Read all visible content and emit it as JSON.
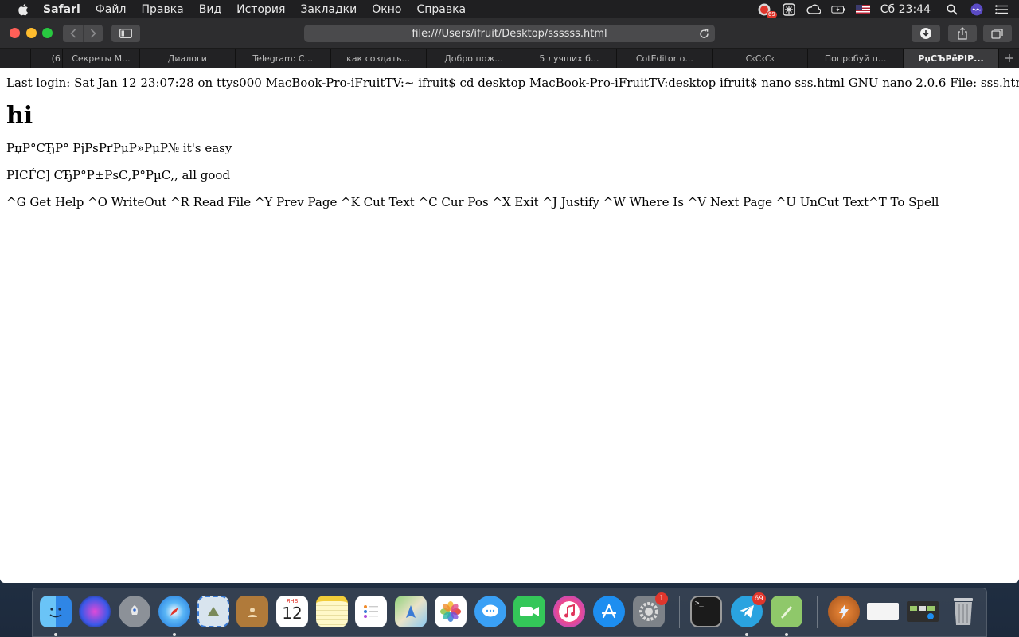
{
  "menubar": {
    "app_name": "Safari",
    "items": [
      "Файл",
      "Правка",
      "Вид",
      "История",
      "Закладки",
      "Окно",
      "Справка"
    ],
    "status_badge": "69",
    "clock": "Сб 23:44"
  },
  "browser": {
    "address": "file:///Users/ifruit/Desktop/ssssss.html",
    "tabs": [
      {
        "label": ""
      },
      {
        "label": "(6"
      },
      {
        "label": "Секреты М..."
      },
      {
        "label": "Диалоги"
      },
      {
        "label": "Telegram: С..."
      },
      {
        "label": "как создать..."
      },
      {
        "label": "Добро пож..."
      },
      {
        "label": "5 лучших б..."
      },
      {
        "label": "CotEditor о..."
      },
      {
        "label": "С‹С‹С‹"
      },
      {
        "label": "Попробуй п..."
      },
      {
        "label": "РџСЪРёРІР..."
      }
    ]
  },
  "page": {
    "line1": "Last login: Sat Jan 12 23:07:28 on ttys000 MacBook-Pro-iFruitTV:~ ifruit$ cd desktop MacBook-Pro-iFruitTV:desktop ifruit$ nano sss.html GNU nano 2.0.6 File: sss.html Modified",
    "heading": "hi",
    "line2": "РџР°СЂР° РјРѕРґРµР»РµР№ it's easy",
    "line3": "РІСЃС] СЂР°Р±РѕС‚Р°РµС‚, all good",
    "line4": "^G Get Help ^O WriteOut ^R Read File ^Y Prev Page ^K Cut Text ^C Cur Pos ^X Exit ^J Justify ^W Where Is ^V Next Page ^U UnCut Text^T To Spell"
  },
  "dock": {
    "calendar_month": "ЯНВ",
    "calendar_day": "12",
    "prefs_badge": "1",
    "telegram_badge": "69"
  },
  "colors": {
    "accent_red": "#e0362c",
    "toolbar": "#2d2d2f",
    "menubar": "#1f1f21"
  }
}
